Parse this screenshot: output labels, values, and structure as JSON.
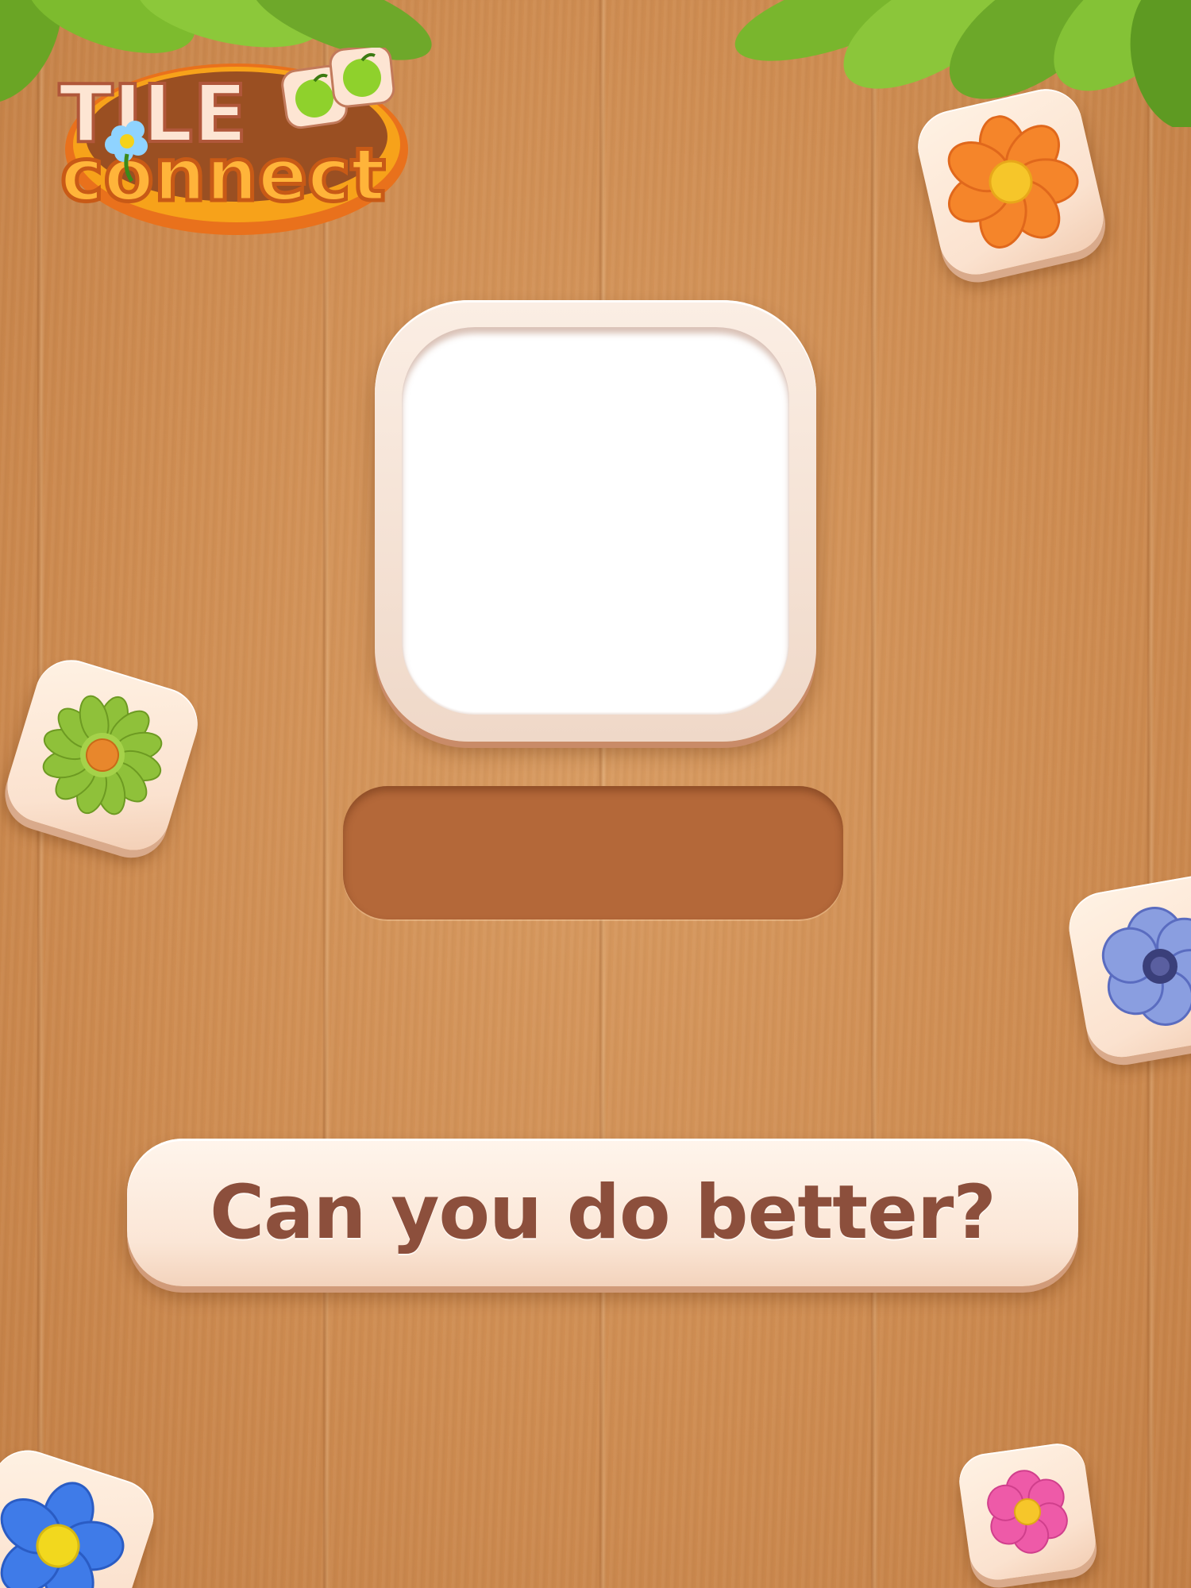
{
  "game": {
    "title_line1": "TILE",
    "title_line2": "connect"
  },
  "photo": {
    "state": "empty"
  },
  "player_name": {
    "value": ""
  },
  "prompt": {
    "text": "Can you do better?"
  },
  "tiles": [
    {
      "id": "orange-flower",
      "icon": "orange-flower-icon",
      "petal_color": "#f5852a",
      "center_color": "#f6c62a"
    },
    {
      "id": "green-flower",
      "icon": "green-flower-icon",
      "petal_color": "#8fc13a",
      "center_color": "#e8872c"
    },
    {
      "id": "blue-purple-flower",
      "icon": "anemone-flower-icon",
      "petal_color": "#8a9ee0",
      "center_color": "#3a3f7a"
    },
    {
      "id": "blue-flower",
      "icon": "blue-flower-icon",
      "petal_color": "#3f7be8",
      "center_color": "#f2d81e"
    },
    {
      "id": "pink-flower",
      "icon": "pink-flower-icon",
      "petal_color": "#ee5aa8",
      "center_color": "#f6c62a"
    }
  ],
  "colors": {
    "wood": "#cf8d52",
    "text_brown": "#8c4f3c",
    "slot_brown": "#b46839",
    "tile_cream": "#fbe2cf"
  }
}
